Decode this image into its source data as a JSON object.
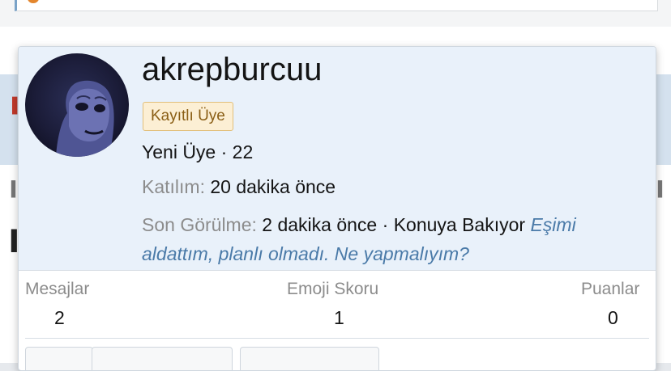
{
  "profile": {
    "username": "akrepburcuu",
    "badge": "Kayıtlı Üye",
    "rank": "Yeni Üye",
    "separator": "·",
    "age": "22",
    "joined_label": "Katılım:",
    "joined_value": "20 dakika önce",
    "last_seen_label": "Son Görülme:",
    "last_seen_value": "2 dakika önce",
    "activity_text": "Konuya Bakıyor",
    "thread_link": "Eşimi aldattım, planlı olmadı. Ne yapmalıyım?"
  },
  "stats": [
    {
      "label": "Mesajlar",
      "value": "2"
    },
    {
      "label": "Emoji Skoru",
      "value": "1"
    },
    {
      "label": "Puanlar",
      "value": "0"
    }
  ],
  "colors": {
    "header_bg": "#e9f1fa",
    "link": "#4a7aa8",
    "badge_bg": "#fcefd4",
    "badge_text": "#8a5e15",
    "muted_text": "#8c8c8c"
  }
}
